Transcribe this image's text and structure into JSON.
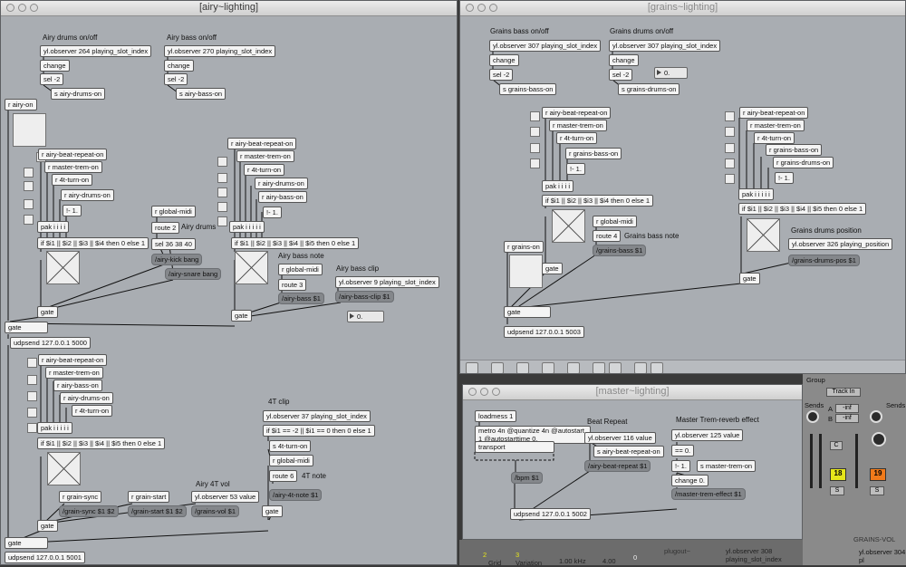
{
  "windows": {
    "airy": {
      "title": "[airy~lighting]",
      "comments": {
        "drums_onoff": "Airy drums on/off",
        "bass_onoff": "Airy bass on/off",
        "drums": "Airy drums",
        "bass_note": "Airy bass note",
        "bass_clip": "Airy bass clip",
        "clip_4t": "4T clip",
        "vol_4t": "Airy 4T vol",
        "note_4t": "4T note"
      },
      "objects": {
        "obs264": "yl.observer 264 playing_slot_index",
        "obs270": "yl.observer 270 playing_slot_index",
        "change": "change",
        "sel2": "sel -2",
        "s_drums_on": "s airy-drums-on",
        "s_bass_on": "s airy-bass-on",
        "r_airy_on": "r airy-on",
        "r_beat_repeat": "r airy-beat-repeat-on",
        "r_master_trem": "r master-trem-on",
        "r_4t_turn": "r 4t-turn-on",
        "r_drums_on": "r airy-drums-on",
        "r_bass_on": "r airy-bass-on",
        "not1": "!- 1.",
        "pak4": "pak i i i i",
        "pak5": "pak i i i i i",
        "if4": "if $i1 || $i2 || $i3 || $i4 then 0 else 1",
        "if5": "if $i1 || $i2 || $i3 || $i4 || $i5 then 0 else 1",
        "r_global_midi": "r global-midi",
        "route2": "route 2",
        "route3": "route 3",
        "route6": "route 6",
        "sel36": "sel 36 38 40",
        "gate": "gate",
        "udp5000": "udpsend 127.0.0.1 5000",
        "udp5001": "udpsend 127.0.0.1 5001",
        "obs9": "yl.observer 9 playing_slot_index",
        "obs37": "yl.observer 37 playing_slot_index",
        "if_clip": "if $i1 == -2 || $i1 == 0 then 0 else 1",
        "s_4t_turn": "s 4t-turn-on",
        "r_grain_sync": "r grain-sync",
        "r_grain_start": "r grain-start",
        "obs53": "yl.observer 53 value"
      },
      "messages": {
        "kick": "/airy-kick bang",
        "snare": "/airy-snare bang",
        "bass1": "/airy-bass $1",
        "bassclip": "/airy-bass-clip $1",
        "grainsync": "/grain-sync $1 $2",
        "grainstart": "/grain-start $1 $2",
        "grainsvol": "/grains-vol $1",
        "note4t": "/airy-4t-note $1"
      },
      "number": "0."
    },
    "grains": {
      "title": "[grains~lighting]",
      "comments": {
        "bass_onoff": "Grains bass on/off",
        "drums_onoff": "Grains drums on/off",
        "bass_note": "Grains bass note",
        "drums_pos": "Grains drums position"
      },
      "objects": {
        "obs307": "yl.observer 307 playing_slot_index",
        "change": "change",
        "sel2": "sel -2",
        "s_bass_on": "s grains-bass-on",
        "s_drums_on": "s grains-drums-on",
        "r_beat_repeat": "r airy-beat-repeat-on",
        "r_master_trem": "r master-trem-on",
        "r_4t_turn": "r 4t-turn-on",
        "r_bass_on": "r grains-bass-on",
        "r_drums_on": "r grains-drums-on",
        "not1": "!- 1.",
        "pak4": "pak i i i i",
        "pak5": "pak i i i i i",
        "if4": "if $i1 || $i2 || $i3 || $i4 then 0 else 1",
        "if5": "if $i1 || $i2 || $i3 || $i4 || $i5 then 0 else 1",
        "r_global_midi": "r global-midi",
        "route4": "route 4",
        "r_grains_on": "r grains-on",
        "obs326": "yl.observer 326 playing_position",
        "gate": "gate",
        "udp5003": "udpsend 127.0.0.1 5003"
      },
      "messages": {
        "grainsbass": "/grains-bass $1",
        "drumspos": "/grains-drums-pos $1"
      },
      "number": "0."
    },
    "master": {
      "title": "[master~lighting]",
      "comments": {
        "beat_repeat": "Beat Repeat",
        "trem": "Master Trem-reverb effect"
      },
      "objects": {
        "loadmess": "loadmess 1",
        "metro": "metro 4n @quantize 4n @autostart 1 @autostarttime 0.",
        "transport": "transport",
        "obs116": "yl.observer 116 value",
        "s_beat_repeat": "s airy-beat-repeat-on",
        "obs125": "yl.observer 125 value",
        "eq0": "== 0.",
        "minus1": "!- 1.",
        "s_trem": "s master-trem-on",
        "change0": "change 0.",
        "udp5002": "udpsend 127.0.0.1 5002"
      },
      "messages": {
        "bpm": "/bpm $1",
        "beatrepeat": "/airy-beat-repeat $1",
        "tremeffect": "/master-trem-effect $1"
      }
    }
  },
  "ableton": {
    "group": "Group",
    "sends": "Sends",
    "track_in": "Track In",
    "send_a": "A",
    "send_b": "B",
    "inf": "-inf",
    "clip_a": "18",
    "clip_b": "19",
    "c": "C",
    "s": "S",
    "grains_vol": "GRAINS-VOL",
    "plugout": "plugout~",
    "obs308": "yl.observer 308 playing_slot_index",
    "obs304": "yl.observer 304 pl",
    "num2": "2",
    "num3": "3",
    "grid": "Grid",
    "variation": "Variation",
    "khz": "1.00 kHz",
    "val400": "4.00",
    "dial0": "0"
  },
  "colors": {
    "patch_bg": "#a9adb2",
    "clip_yellow": "#e6e61a",
    "clip_orange": "#f07a1a"
  }
}
